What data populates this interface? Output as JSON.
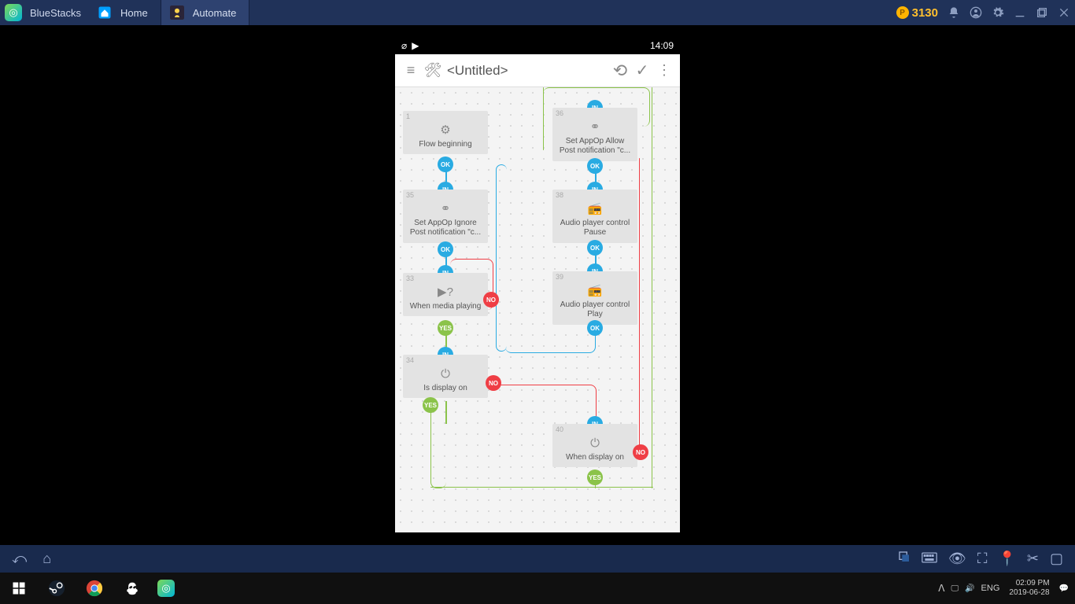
{
  "bluestacks": {
    "brand": "BlueStacks",
    "tabs": [
      {
        "label": "Home"
      },
      {
        "label": "Automate"
      }
    ],
    "coins": "3130"
  },
  "android_status": {
    "time": "14:09"
  },
  "app": {
    "title": "<Untitled>",
    "blocks": {
      "b1": {
        "num": "1",
        "label": "Flow beginning"
      },
      "b35": {
        "num": "35",
        "label": "Set AppOp Ignore\nPost notification \"c..."
      },
      "b33": {
        "num": "33",
        "label": "When media playing"
      },
      "b34": {
        "num": "34",
        "label": "Is display on"
      },
      "b36": {
        "num": "36",
        "label": "Set AppOp Allow\nPost notification \"c..."
      },
      "b38": {
        "num": "38",
        "label": "Audio player control\nPause"
      },
      "b39": {
        "num": "39",
        "label": "Audio player control\nPlay"
      },
      "b40": {
        "num": "40",
        "label": "When display on"
      }
    },
    "port_labels": {
      "in": "IN",
      "ok": "OK",
      "yes": "YES",
      "no": "NO"
    }
  },
  "win_tray": {
    "lang": "ENG",
    "time": "02:09 PM",
    "date": "2019-06-28"
  }
}
